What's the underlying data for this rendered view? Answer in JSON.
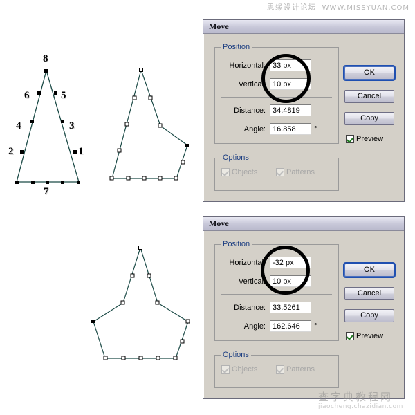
{
  "watermarks": {
    "top_cn": "思缘设计论坛",
    "top_url": "WWW.MISSYUAN.COM",
    "bottom_cn": "查字典教程网",
    "bottom_url": "jiaocheng.chazidian.com"
  },
  "canvas": {
    "stroke_color": "#1b4a46",
    "anchor_fill_color": "#000000",
    "anchor_hollow_color": "#ffffff",
    "shapes": [
      {
        "name": "numbered-triangle",
        "label_numbers": [
          "1",
          "2",
          "3",
          "4",
          "5",
          "6",
          "7",
          "8"
        ]
      },
      {
        "name": "distorted-polygon"
      },
      {
        "name": "pentagon-star-shape"
      }
    ]
  },
  "dialogs": [
    {
      "title": "Move",
      "position_group": {
        "title": "Position",
        "horizontal_label": "Horizontal:",
        "horizontal_value": "33 px",
        "vertical_label": "Vertical:",
        "vertical_value": "10 px",
        "distance_label": "Distance:",
        "distance_value": "34.4819",
        "angle_label": "Angle:",
        "angle_value": "16.858",
        "angle_unit": "°"
      },
      "options_group": {
        "title": "Options",
        "objects_label": "Objects",
        "objects_checked": true,
        "patterns_label": "Patterns",
        "patterns_checked": true
      },
      "buttons": {
        "ok": "OK",
        "cancel": "Cancel",
        "copy": "Copy"
      },
      "preview": {
        "label": "Preview",
        "checked": true
      }
    },
    {
      "title": "Move",
      "position_group": {
        "title": "Position",
        "horizontal_label": "Horizontal:",
        "horizontal_value": "-32 px",
        "vertical_label": "Vertical:",
        "vertical_value": "10 px",
        "distance_label": "Distance:",
        "distance_value": "33.5261",
        "angle_label": "Angle:",
        "angle_value": "162.646",
        "angle_unit": "°"
      },
      "options_group": {
        "title": "Options",
        "objects_label": "Objects",
        "objects_checked": true,
        "patterns_label": "Patterns",
        "patterns_checked": true
      },
      "buttons": {
        "ok": "OK",
        "cancel": "Cancel",
        "copy": "Copy"
      },
      "preview": {
        "label": "Preview",
        "checked": true
      }
    }
  ]
}
